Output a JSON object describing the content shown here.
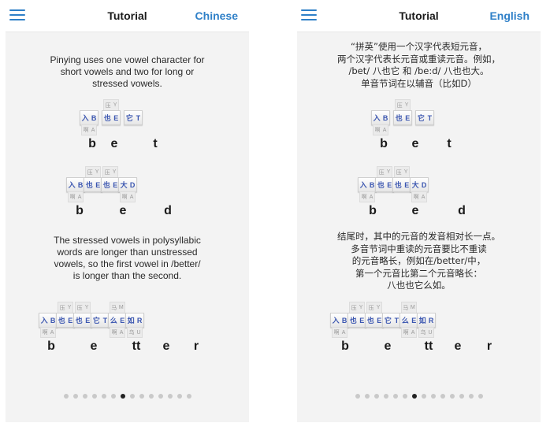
{
  "left": {
    "header": {
      "title": "Tutorial",
      "lang_button": "Chinese"
    },
    "intro": "Pinying uses one vowel character for\nshort vowels and two for long or\nstressed vowels.",
    "bet_letters": [
      "b",
      "e",
      "t"
    ],
    "bed_letters": [
      "b",
      "e",
      "d"
    ],
    "body2": "The stressed vowels in polysyllabic\nwords are longer than unstressed\nvowels, so the first vowel in /better/\nis longer than the second.",
    "better_letters": [
      "b",
      "e",
      "tt",
      "e",
      "r"
    ],
    "pager": {
      "total": 14,
      "active_index": 6
    }
  },
  "right": {
    "header": {
      "title": "Tutorial",
      "lang_button": "English"
    },
    "intro": "“拼英”使用一个汉字代表短元音，\n两个汉字代表长元音或重读元音。例如，\n/bet/ 八也它  和  /be:d/ 八也也大。\n单音节词在以辅音（比如D）",
    "bet_letters": [
      "b",
      "e",
      "t"
    ],
    "bed_letters": [
      "b",
      "e",
      "d"
    ],
    "body2": "结尾时，其中的元音的发音相对长一点。\n多音节词中重读的元音要比不重读\n的元音略长，例如在/better/中，\n第一个元音比第二个元音略长：\n八也也它么如。",
    "better_letters": [
      "b",
      "e",
      "tt",
      "e",
      "r"
    ],
    "pager": {
      "total": 14,
      "active_index": 6
    }
  },
  "cube_glyphs": {
    "ba": {
      "face": [
        "入",
        "B"
      ],
      "bot": [
        "啊",
        "A"
      ]
    },
    "ye": {
      "top": [
        "压",
        "Y"
      ],
      "face": [
        "也",
        "E"
      ]
    },
    "ta": {
      "face": [
        "它",
        "T"
      ]
    },
    "da": {
      "face": [
        "大",
        "D"
      ],
      "bot": [
        "啊",
        "A"
      ]
    },
    "me": {
      "top": [
        "马",
        "M"
      ],
      "face": [
        "么",
        "E"
      ],
      "bot": [
        "啊",
        "A"
      ]
    },
    "ru": {
      "face": [
        "如",
        "R"
      ],
      "bot": [
        "乌",
        "U"
      ]
    }
  }
}
